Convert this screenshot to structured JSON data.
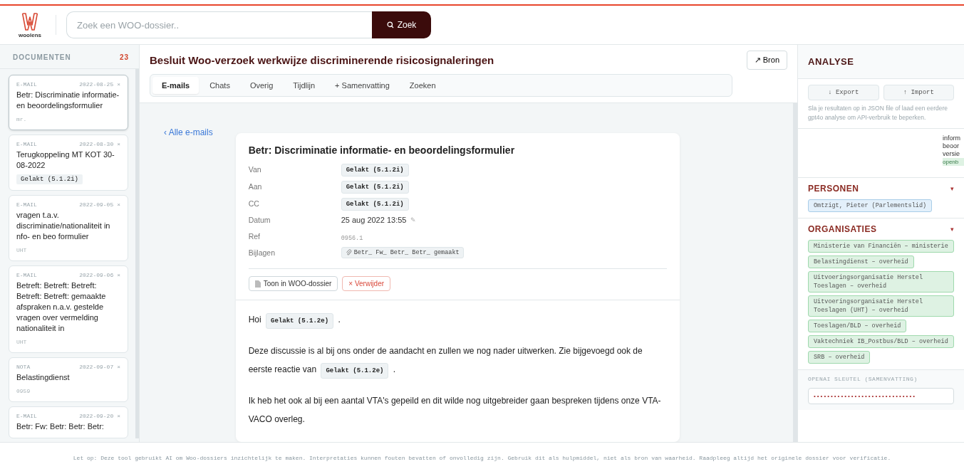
{
  "header": {
    "logo_text": "woolens",
    "search": {
      "placeholder": "Zoek een WOO-dossier.."
    },
    "search_button": "Zoek"
  },
  "sidebar": {
    "title": "DOCUMENTEN",
    "count": "23",
    "items": [
      {
        "type": "E-MAIL",
        "date": "2022-08-25",
        "close": "×",
        "title": "Betr: Discriminatie informatie- en beoordelingsformulier",
        "meta": "mr.",
        "selected": true
      },
      {
        "type": "E-MAIL",
        "date": "2022-08-30",
        "close": "×",
        "title": "Terugkoppeling MT KOT 30-08-2022",
        "tag": "Gelakt (5.1.2i)",
        "selected": false
      },
      {
        "type": "E-MAIL",
        "date": "2022-09-05",
        "close": "×",
        "title": "vragen t.a.v. discriminatie/nationaliteit in nfo- en beo formulier",
        "meta": "UHT",
        "selected": false
      },
      {
        "type": "E-MAIL",
        "date": "2022-09-06",
        "close": "×",
        "title": "Betreft: Betreft: Betreft: Betreft: Betreft: gemaakte afspraken n.a.v. gestelde vragen over vermelding nationaliteit in",
        "meta": "UHT",
        "selected": false
      },
      {
        "type": "NOTA",
        "date": "2022-09-07",
        "close": "×",
        "title": "Belastingdienst",
        "meta": "0959",
        "selected": false
      },
      {
        "type": "E-MAIL",
        "date": "2022-09-20",
        "close": "×",
        "title": "Betr: Fw: Betr: Betr: Betr:",
        "selected": false
      }
    ]
  },
  "dossier": {
    "title": "Besluit Woo-verzoek werkwijze discriminerende risicosignaleringen",
    "source_button": "↗ Bron",
    "tabs": [
      {
        "label": "E-mails",
        "selected": true
      },
      {
        "label": "Chats",
        "selected": false
      },
      {
        "label": "Overig",
        "selected": false
      },
      {
        "label": "Tijdlijn",
        "selected": false
      },
      {
        "label": "+ Samenvatting",
        "selected": false
      },
      {
        "label": "Zoeken",
        "selected": false
      }
    ],
    "back_link": "‹ Alle e-mails",
    "email": {
      "subject": "Betr: Discriminatie informatie- en beoordelingsformulier",
      "fields": [
        {
          "label": "Van",
          "kind": "redacted",
          "value": "Gelakt (5.1.2i)"
        },
        {
          "label": "Aan",
          "kind": "redacted",
          "value": "Gelakt (5.1.2i)"
        },
        {
          "label": "CC",
          "kind": "redacted",
          "value": "Gelakt (5.1.2i)"
        },
        {
          "label": "Datum",
          "kind": "date",
          "value": "25 aug 2022 13:55",
          "edit": "✎"
        },
        {
          "label": "Ref",
          "kind": "ref",
          "value": "0956.1"
        },
        {
          "label": "Bijlagen",
          "kind": "attachment",
          "value": "Betr_ Fw_ Betr_ Betr_ gemaakt"
        }
      ],
      "buttons": [
        {
          "label": "Toon in WOO-dossier",
          "kind": "open"
        },
        {
          "label": "× Verwijder",
          "kind": "delete"
        }
      ],
      "body": [
        [
          {
            "kind": "text",
            "text": "Hoi"
          },
          {
            "kind": "redacted",
            "text": "Gelakt (5.1.2e)"
          },
          {
            "kind": "text",
            "text": "."
          }
        ],
        [
          {
            "kind": "text",
            "text": "Deze discussie is al bij ons onder de aandacht en zullen we nog nader uitwerken. Zie bijgevoegd ook de eerste reactie van"
          },
          {
            "kind": "redacted",
            "text": "Gelakt (5.1.2e)"
          },
          {
            "kind": "text",
            "text": "."
          }
        ],
        [
          {
            "kind": "text",
            "text": "Ik heb het ook al bij een aantal VTA's gepeild en dit wilde nog uitgebreider gaan bespreken tijdens onze VTA-VACO overleg."
          }
        ]
      ]
    }
  },
  "analysis": {
    "title": "ANALYSE",
    "export_button": "↓ Export",
    "import_button": "↑ Import",
    "hint": "Sla je resultaten op in JSON file of laad een eerdere gpt4o analyse om API-verbruik te beperken.",
    "fragment_lines": [
      "inform",
      "beoor",
      "versie"
    ],
    "fragment_badge": "openb",
    "sections": [
      {
        "title": "PERSONEN",
        "kind": "person",
        "expanded": true,
        "toggle": "▾",
        "tags": [
          "Omtzigt, Pieter (Parlementslid)"
        ]
      },
      {
        "title": "ORGANISATIES",
        "kind": "organisation",
        "expanded": true,
        "toggle": "▾",
        "tags": [
          "Ministerie van Financiën – ministerie",
          "Belastingdienst – overheid",
          "Uitvoeringsorganisatie Herstel Toeslagen – overheid",
          "Uitvoeringsorganisatie Herstel Toeslagen (UHT) – overheid",
          "Toeslagen/BLD – overheid",
          "Vaktechniek IB_Postbus/BLD – overheid",
          "SRB – overheid"
        ]
      }
    ],
    "key_label": "OPENAI SLEUTEL (SAMENVATTING)",
    "key_field": {
      "value": "••••••••••••••••••••••••••••••"
    }
  },
  "footer": "Let op: Deze tool gebruikt AI om Woo-dossiers inzichtelijk te maken. Interpretaties kunnen fouten bevatten of onvolledig zijn. Gebruik dit als hulpmiddel, niet als bron van waarheid. Raadpleeg altijd het originele dossier voor verificatie."
}
